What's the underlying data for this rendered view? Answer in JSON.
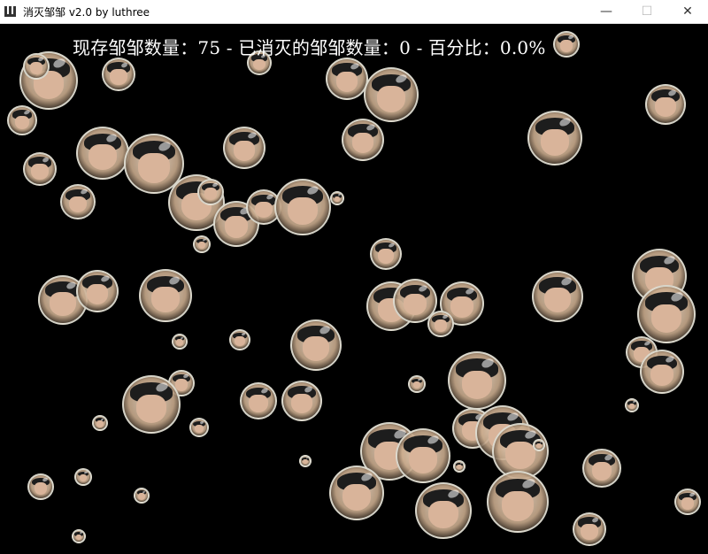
{
  "window": {
    "title": "消灭邹邹 v2.0 by luthree",
    "minimize_symbol": "—",
    "maximize_symbol": "☐",
    "close_symbol": "✕",
    "icon": "app-logo-icon"
  },
  "hud": {
    "text": "现存邹邹数量：75 - 已消灭的邹邹数量：0 - 百分比：0.0%"
  },
  "game": {
    "remaining_count": 75,
    "destroyed_count": 0,
    "percent": "0.0%",
    "sprite": "face-bubble-icon",
    "background_color": "#000000"
  }
}
